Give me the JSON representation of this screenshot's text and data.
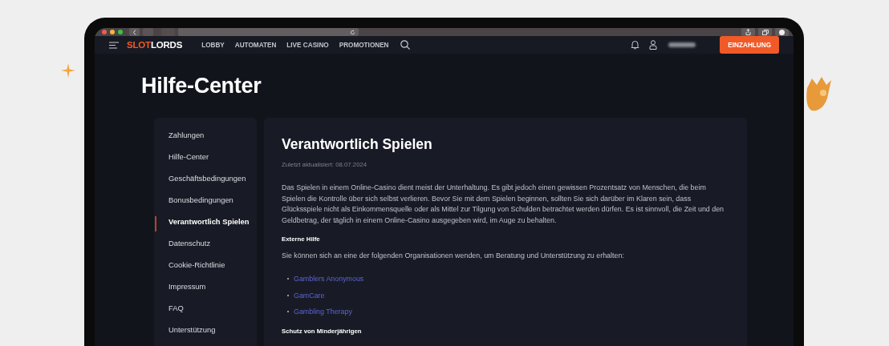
{
  "nav": {
    "logo": {
      "first": "SLOT",
      "second": "LORDS"
    },
    "links": [
      "LOBBY",
      "AUTOMATEN",
      "LIVE CASINO",
      "PROMOTIONEN"
    ],
    "deposit_button": "EINZAHLUNG"
  },
  "page_title": "Hilfe-Center",
  "sidebar": {
    "items": [
      {
        "label": "Zahlungen",
        "selected": false
      },
      {
        "label": "Hilfe-Center",
        "selected": false
      },
      {
        "label": "Geschäftsbedingungen",
        "selected": false
      },
      {
        "label": "Bonusbedingungen",
        "selected": false
      },
      {
        "label": "Verantwortlich Spielen",
        "selected": true
      },
      {
        "label": "Datenschutz",
        "selected": false
      },
      {
        "label": "Cookie-Richtlinie",
        "selected": false
      },
      {
        "label": "Impressum",
        "selected": false
      },
      {
        "label": "FAQ",
        "selected": false
      },
      {
        "label": "Unterstützung",
        "selected": false
      }
    ]
  },
  "article": {
    "title": "Verantwortlich Spielen",
    "updated": "Zuletzt aktualisiert: 08.07.2024",
    "blocks": [
      {
        "kind": "paragraph",
        "text": "Das Spielen in einem Online-Casino dient meist der Unterhaltung. Es gibt jedoch einen gewissen Prozentsatz von Menschen, die beim Spielen die Kontrolle über sich selbst verlieren. Bevor Sie mit dem Spielen beginnen, sollten Sie sich darüber im Klaren sein, dass Glücksspiele nicht als Einkommensquelle oder als Mittel zur Tilgung von Schulden betrachtet werden dürfen. Es ist sinnvoll, die Zeit und den Geldbetrag, der täglich in einem Online-Casino ausgegeben wird, im Auge zu behalten."
      },
      {
        "kind": "heading",
        "text": "Externe Hilfe"
      },
      {
        "kind": "paragraph",
        "text": "Sie können sich an eine der folgenden Organisationen wenden, um Beratung und Unterstützung zu erhalten:"
      },
      {
        "kind": "links",
        "items": [
          "Gamblers Anonymous",
          "GamCare",
          "Gambling Therapy"
        ]
      },
      {
        "kind": "heading",
        "text": "Schutz von Minderjährigen"
      }
    ]
  }
}
